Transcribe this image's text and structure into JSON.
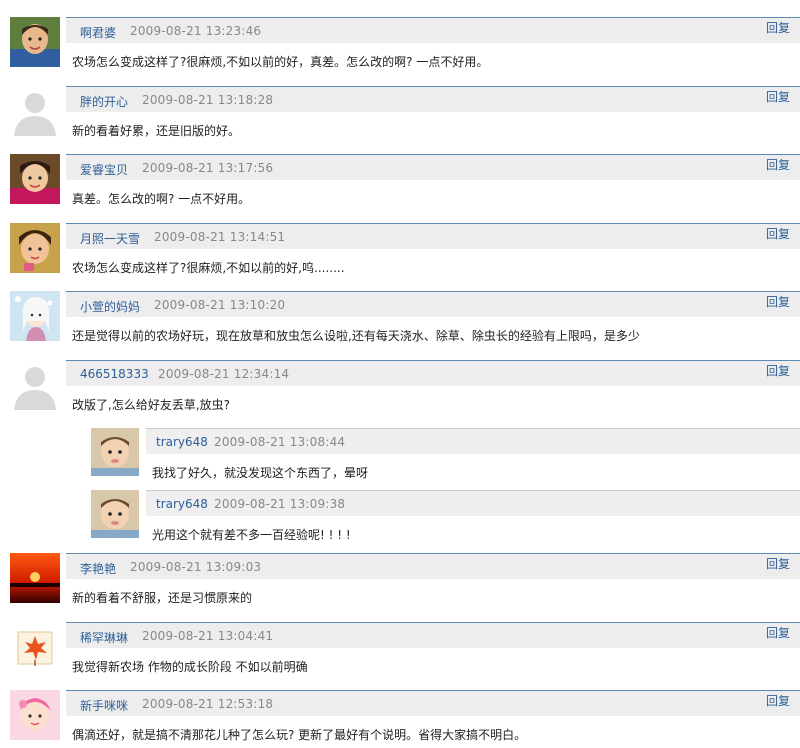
{
  "reply_label": "回复",
  "comments": [
    {
      "user": "啊君婆",
      "time": "2009-08-21 13:23:46",
      "text": "农场怎么变成这样了?很麻烦,不如以前的好，真差。怎么改的啊? 一点不好用。",
      "avatar": "child-photo"
    },
    {
      "user": "胖的开心",
      "time": "2009-08-21 13:18:28",
      "text": "新的看着好累，还是旧版的好。",
      "avatar": "default-silhouette"
    },
    {
      "user": "爱睿宝贝",
      "time": "2009-08-21 13:17:56",
      "text": "真差。怎么改的啊? 一点不好用。",
      "avatar": "child-photo"
    },
    {
      "user": "月照一天雪",
      "time": "2009-08-21 13:14:51",
      "text": "农场怎么变成这样了?很麻烦,不如以前的好,呜........",
      "avatar": "child-photo"
    },
    {
      "user": "小萱的妈妈",
      "time": "2009-08-21 13:10:20",
      "text": "还是觉得以前的农场好玩，现在放草和放虫怎么设啦,还有每天浇水、除草、除虫长的经验有上限吗，是多少",
      "avatar": "cartoon-girl"
    },
    {
      "user": "466518333",
      "time": "2009-08-21 12:34:14",
      "text": "改版了,怎么给好友丢草,放虫?",
      "avatar": "default-silhouette",
      "replies": [
        {
          "user": "trary648",
          "time": "2009-08-21 13:08:44",
          "text": "我找了好久，就没发现这个东西了，晕呀",
          "avatar": "baby-photo"
        },
        {
          "user": "trary648",
          "time": "2009-08-21 13:09:38",
          "text": "光用这个就有差不多一百经验呢! ! ! !",
          "avatar": "baby-photo"
        }
      ]
    },
    {
      "user": "李艳艳",
      "time": "2009-08-21 13:09:03",
      "text": "新的看着不舒服，还是习惯原来的",
      "avatar": "sunset"
    },
    {
      "user": "稀罕琳琳",
      "time": "2009-08-21 13:04:41",
      "text": "我觉得新农场 作物的成长阶段 不如以前明确",
      "avatar": "maple-leaf"
    },
    {
      "user": "新手咪咪",
      "time": "2009-08-21 12:53:18",
      "text": "偶滴还好，就是搞不清那花儿种了怎么玩? 更新了最好有个说明。省得大家搞不明白。",
      "avatar": "baby-pink"
    }
  ],
  "colors": {
    "link": "#2d5f99",
    "header_bg": "#ededed",
    "header_border": "#5b8bb5",
    "time": "#888888"
  }
}
